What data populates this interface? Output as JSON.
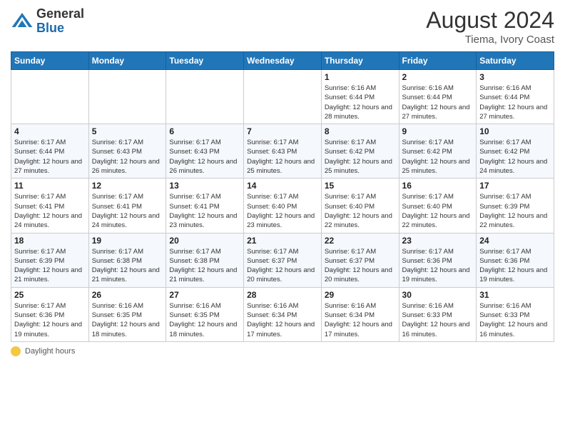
{
  "logo": {
    "general": "General",
    "blue": "Blue"
  },
  "header": {
    "month_year": "August 2024",
    "location": "Tiema, Ivory Coast"
  },
  "weekdays": [
    "Sunday",
    "Monday",
    "Tuesday",
    "Wednesday",
    "Thursday",
    "Friday",
    "Saturday"
  ],
  "legend": {
    "label": "Daylight hours"
  },
  "weeks": [
    [
      {
        "day": "",
        "info": ""
      },
      {
        "day": "",
        "info": ""
      },
      {
        "day": "",
        "info": ""
      },
      {
        "day": "",
        "info": ""
      },
      {
        "day": "1",
        "info": "Sunrise: 6:16 AM\nSunset: 6:44 PM\nDaylight: 12 hours\nand 28 minutes."
      },
      {
        "day": "2",
        "info": "Sunrise: 6:16 AM\nSunset: 6:44 PM\nDaylight: 12 hours\nand 27 minutes."
      },
      {
        "day": "3",
        "info": "Sunrise: 6:16 AM\nSunset: 6:44 PM\nDaylight: 12 hours\nand 27 minutes."
      }
    ],
    [
      {
        "day": "4",
        "info": "Sunrise: 6:17 AM\nSunset: 6:44 PM\nDaylight: 12 hours\nand 27 minutes."
      },
      {
        "day": "5",
        "info": "Sunrise: 6:17 AM\nSunset: 6:43 PM\nDaylight: 12 hours\nand 26 minutes."
      },
      {
        "day": "6",
        "info": "Sunrise: 6:17 AM\nSunset: 6:43 PM\nDaylight: 12 hours\nand 26 minutes."
      },
      {
        "day": "7",
        "info": "Sunrise: 6:17 AM\nSunset: 6:43 PM\nDaylight: 12 hours\nand 25 minutes."
      },
      {
        "day": "8",
        "info": "Sunrise: 6:17 AM\nSunset: 6:42 PM\nDaylight: 12 hours\nand 25 minutes."
      },
      {
        "day": "9",
        "info": "Sunrise: 6:17 AM\nSunset: 6:42 PM\nDaylight: 12 hours\nand 25 minutes."
      },
      {
        "day": "10",
        "info": "Sunrise: 6:17 AM\nSunset: 6:42 PM\nDaylight: 12 hours\nand 24 minutes."
      }
    ],
    [
      {
        "day": "11",
        "info": "Sunrise: 6:17 AM\nSunset: 6:41 PM\nDaylight: 12 hours\nand 24 minutes."
      },
      {
        "day": "12",
        "info": "Sunrise: 6:17 AM\nSunset: 6:41 PM\nDaylight: 12 hours\nand 24 minutes."
      },
      {
        "day": "13",
        "info": "Sunrise: 6:17 AM\nSunset: 6:41 PM\nDaylight: 12 hours\nand 23 minutes."
      },
      {
        "day": "14",
        "info": "Sunrise: 6:17 AM\nSunset: 6:40 PM\nDaylight: 12 hours\nand 23 minutes."
      },
      {
        "day": "15",
        "info": "Sunrise: 6:17 AM\nSunset: 6:40 PM\nDaylight: 12 hours\nand 22 minutes."
      },
      {
        "day": "16",
        "info": "Sunrise: 6:17 AM\nSunset: 6:40 PM\nDaylight: 12 hours\nand 22 minutes."
      },
      {
        "day": "17",
        "info": "Sunrise: 6:17 AM\nSunset: 6:39 PM\nDaylight: 12 hours\nand 22 minutes."
      }
    ],
    [
      {
        "day": "18",
        "info": "Sunrise: 6:17 AM\nSunset: 6:39 PM\nDaylight: 12 hours\nand 21 minutes."
      },
      {
        "day": "19",
        "info": "Sunrise: 6:17 AM\nSunset: 6:38 PM\nDaylight: 12 hours\nand 21 minutes."
      },
      {
        "day": "20",
        "info": "Sunrise: 6:17 AM\nSunset: 6:38 PM\nDaylight: 12 hours\nand 21 minutes."
      },
      {
        "day": "21",
        "info": "Sunrise: 6:17 AM\nSunset: 6:37 PM\nDaylight: 12 hours\nand 20 minutes."
      },
      {
        "day": "22",
        "info": "Sunrise: 6:17 AM\nSunset: 6:37 PM\nDaylight: 12 hours\nand 20 minutes."
      },
      {
        "day": "23",
        "info": "Sunrise: 6:17 AM\nSunset: 6:36 PM\nDaylight: 12 hours\nand 19 minutes."
      },
      {
        "day": "24",
        "info": "Sunrise: 6:17 AM\nSunset: 6:36 PM\nDaylight: 12 hours\nand 19 minutes."
      }
    ],
    [
      {
        "day": "25",
        "info": "Sunrise: 6:17 AM\nSunset: 6:36 PM\nDaylight: 12 hours\nand 19 minutes."
      },
      {
        "day": "26",
        "info": "Sunrise: 6:16 AM\nSunset: 6:35 PM\nDaylight: 12 hours\nand 18 minutes."
      },
      {
        "day": "27",
        "info": "Sunrise: 6:16 AM\nSunset: 6:35 PM\nDaylight: 12 hours\nand 18 minutes."
      },
      {
        "day": "28",
        "info": "Sunrise: 6:16 AM\nSunset: 6:34 PM\nDaylight: 12 hours\nand 17 minutes."
      },
      {
        "day": "29",
        "info": "Sunrise: 6:16 AM\nSunset: 6:34 PM\nDaylight: 12 hours\nand 17 minutes."
      },
      {
        "day": "30",
        "info": "Sunrise: 6:16 AM\nSunset: 6:33 PM\nDaylight: 12 hours\nand 16 minutes."
      },
      {
        "day": "31",
        "info": "Sunrise: 6:16 AM\nSunset: 6:33 PM\nDaylight: 12 hours\nand 16 minutes."
      }
    ]
  ]
}
